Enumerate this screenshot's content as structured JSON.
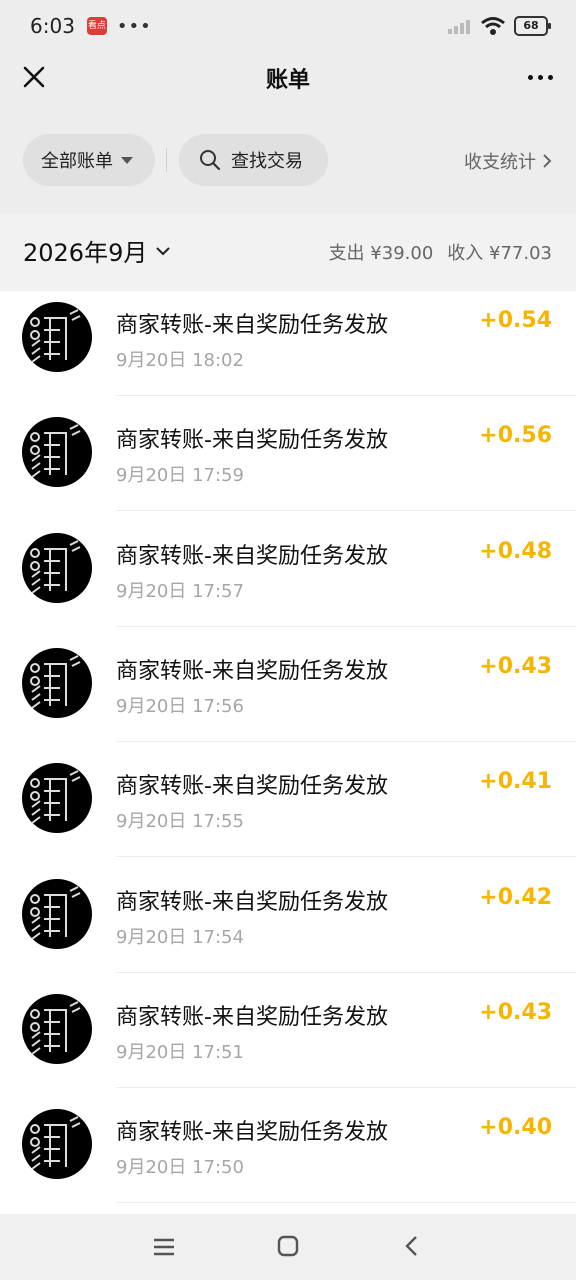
{
  "status_bar": {
    "time": "6:03",
    "badge": "看点",
    "dots": "•••",
    "battery": "68"
  },
  "nav": {
    "title": "账单"
  },
  "filters": {
    "all_bills": "全部账单",
    "search": "查找交易",
    "stats": "收支统计"
  },
  "summary": {
    "month": "2026年9月",
    "expense": "支出 ¥39.00",
    "income": "收入 ¥77.03"
  },
  "transactions": [
    {
      "title": "商家转账-来自奖励任务发放",
      "time": "9月20日 18:02",
      "amount": "+0.54"
    },
    {
      "title": "商家转账-来自奖励任务发放",
      "time": "9月20日 17:59",
      "amount": "+0.56"
    },
    {
      "title": "商家转账-来自奖励任务发放",
      "time": "9月20日 17:57",
      "amount": "+0.48"
    },
    {
      "title": "商家转账-来自奖励任务发放",
      "time": "9月20日 17:56",
      "amount": "+0.43"
    },
    {
      "title": "商家转账-来自奖励任务发放",
      "time": "9月20日 17:55",
      "amount": "+0.41"
    },
    {
      "title": "商家转账-来自奖励任务发放",
      "time": "9月20日 17:54",
      "amount": "+0.42"
    },
    {
      "title": "商家转账-来自奖励任务发放",
      "time": "9月20日 17:51",
      "amount": "+0.43"
    },
    {
      "title": "商家转账-来自奖励任务发放",
      "time": "9月20日 17:50",
      "amount": "+0.40"
    }
  ],
  "icons": {
    "close": "close-icon",
    "more": "more-icon",
    "search": "search-icon",
    "chevron_right": "chevron-right-icon",
    "chevron_down": "chevron-down-icon",
    "menu": "menu-icon",
    "home": "home-icon",
    "back": "back-icon"
  },
  "colors": {
    "income_amount": "#f5b500",
    "page_bg": "#ededed"
  }
}
